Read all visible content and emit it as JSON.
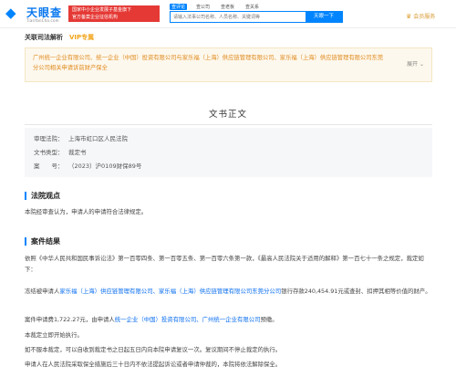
{
  "header": {
    "logo_mark": "◆",
    "logo_text": "天眼查",
    "logo_sub": "TianYanCha.com",
    "gov_banner_line1": "国家中小企业发展子基金旗下",
    "gov_banner_line2": "官方备案企业征信机构",
    "search_tabs": [
      "查评论",
      "查公司",
      "查老板",
      "查关系"
    ],
    "search_placeholder": "请输入法事公司名称、人员名称、关键词等",
    "search_button": "天眼一下",
    "member_icon": "crown-icon",
    "member_label": "会员服务"
  },
  "subheader": {
    "title": "关联司法解析",
    "vip": "VIP专属"
  },
  "related": {
    "text": "广州统一企业有限公司、统一企业（中国）投资有限公司与家乐福（上海）供应链管理有限公司、家乐福（上海）供应链管理有限公司东莞分公司相关申请诉前财产保全",
    "expand_label": "展开",
    "expand_icon": "chevron-down-icon"
  },
  "document": {
    "title": "文书正文",
    "meta": [
      {
        "key": "审理法院：",
        "value": "上海市虹口区人民法院"
      },
      {
        "key": "文书类型：",
        "value": "裁定书"
      },
      {
        "key": "案　　号：",
        "value": "（2023）沪0109财保89号"
      }
    ]
  },
  "sections": {
    "opinion_title": "法院观点",
    "opinion_text": "本院经审查认为，申请人的申请符合法律规定。",
    "result_title": "案件结果",
    "result_p1": "依照《中华人民共和国民事诉讼法》第一百零四条、第一百零五条、第一百零六条第一款，《最高人民法院关于适用的解释》第一百七十一条之规定，裁定如下：",
    "result_p2_a": "冻结被申请人",
    "result_p2_b": "家乐福（上海）供应链管理有限公司、家乐福（上海）供应链管理有限公司东莞分公司",
    "result_p2_c": "银行存款240,454.91元或查封、扣押其相等价值的财产。",
    "result_p3_a": "案件申请费1,722.27元，由申请人",
    "result_p3_b": "统一企业（中国）投资有限公司、广州统一企业有限公司",
    "result_p3_c": "预缴。",
    "result_p4": "本裁定立即开始执行。",
    "result_p5": "如不服本裁定，可以自收到裁定书之日起五日内向本院申请复议一次。复议期间不停止裁定的执行。",
    "result_p6": "申请人在人民法院采取保全措施后三十日内不依法提起诉讼或者申请仲裁的，本院将依法解除保全。"
  }
}
